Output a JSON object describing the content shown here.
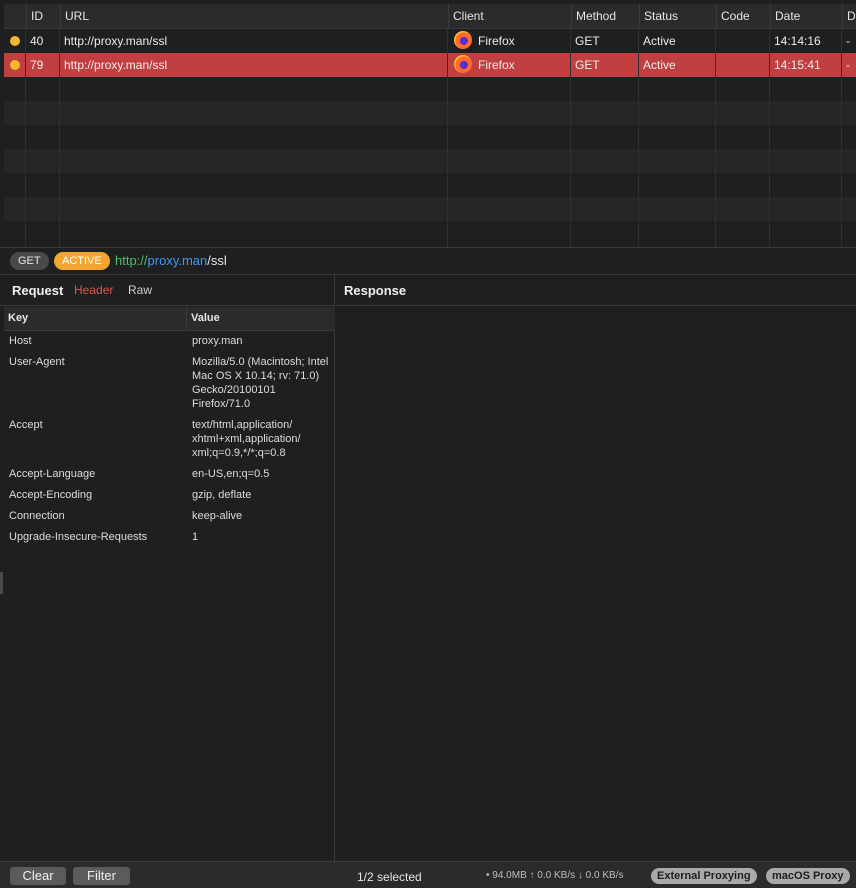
{
  "table": {
    "columns": [
      "ID",
      "URL",
      "Client",
      "Method",
      "Status",
      "Code",
      "Date",
      "Du"
    ],
    "rows": [
      {
        "id": "40",
        "url": "http://proxy.man/ssl",
        "client": "Firefox",
        "method": "GET",
        "status": "Active",
        "code": "",
        "date": "14:14:16",
        "duration": "-"
      },
      {
        "id": "79",
        "url": "http://proxy.man/ssl",
        "client": "Firefox",
        "method": "GET",
        "status": "Active",
        "code": "",
        "date": "14:15:41",
        "duration": "-"
      }
    ],
    "selected_index": 1,
    "status_dot_color": "#f5b72b",
    "selection_color": "#c04041"
  },
  "urlbar": {
    "method": "GET",
    "status": "ACTIVE",
    "scheme": "http://",
    "host": "proxy.man",
    "path": "/ssl"
  },
  "request": {
    "title": "Request",
    "tabs": [
      "Header",
      "Raw"
    ],
    "active_tab": "Header",
    "key_header": "Key",
    "value_header": "Value",
    "headers": [
      {
        "key": "Host",
        "value": "proxy.man"
      },
      {
        "key": "User-Agent",
        "value": "Mozilla/5.0 (Macintosh; Intel Mac OS X 10.14; rv: 71.0) Gecko/20100101 Firefox/71.0"
      },
      {
        "key": "Accept",
        "value": "text/html,application/ xhtml+xml,application/ xml;q=0.9,*/*;q=0.8"
      },
      {
        "key": "Accept-Language",
        "value": "en-US,en;q=0.5"
      },
      {
        "key": "Accept-Encoding",
        "value": "gzip, deflate"
      },
      {
        "key": "Connection",
        "value": "keep-alive"
      },
      {
        "key": "Upgrade-Insecure-Requests",
        "value": "1"
      }
    ]
  },
  "response": {
    "title": "Response"
  },
  "bottombar": {
    "clear_label": "Clear",
    "filter_label": "Filter",
    "selection": "1/2 selected",
    "stats": "• 94.0MB ↑ 0.0 KB/s ↓ 0.0 KB/s",
    "external_proxying": "External Proxying",
    "macos_proxy": "macOS Proxy"
  }
}
